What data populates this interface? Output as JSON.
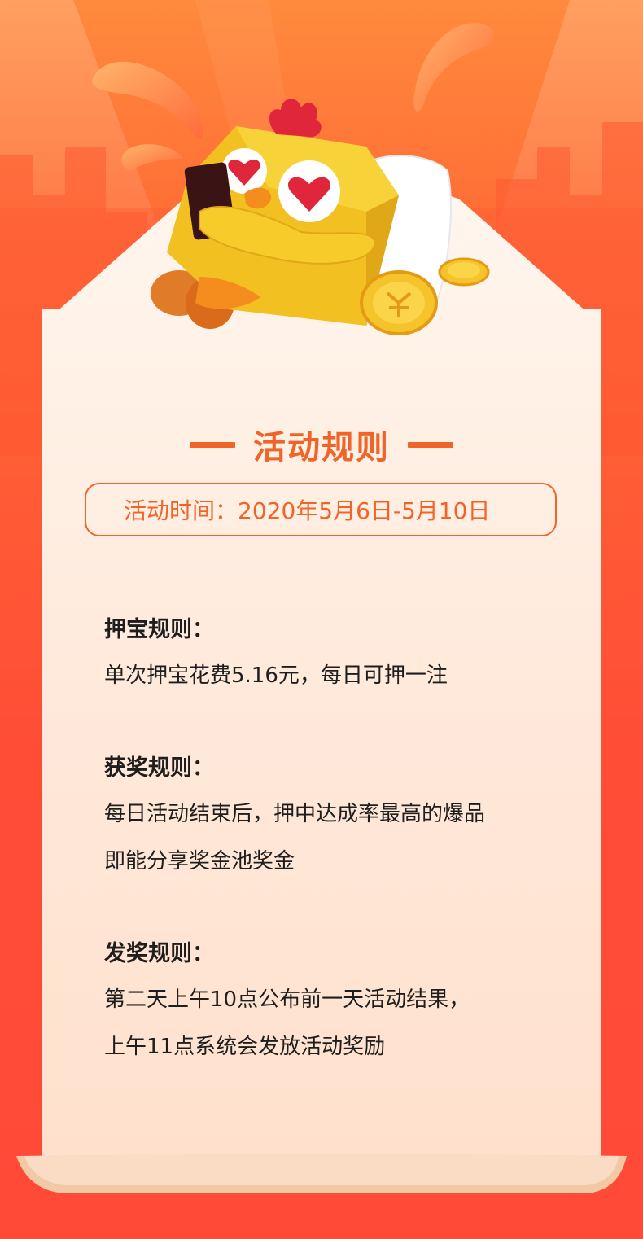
{
  "header": {
    "title": "活动规则",
    "time_text": "活动时间：2020年5月6日-5月10日"
  },
  "rules": [
    {
      "heading": "押宝规则：",
      "lines": [
        "单次押宝花费5.16元，每日可押一注"
      ]
    },
    {
      "heading": "获奖规则：",
      "lines": [
        "每日活动结束后，押中达成率最高的爆品",
        "即能分享奖金池奖金"
      ]
    },
    {
      "heading": "发奖规则：",
      "lines": [
        "第二天上午10点公布前一天活动结果，",
        "上午11点系统会发放活动奖励"
      ]
    }
  ],
  "icons": {
    "mascot": "chicken-mascot-with-phone-icon",
    "coins": "gold-coin-icon"
  },
  "colors": {
    "accent": "#f0642a",
    "bg_top": "#ff8a3d",
    "bg_bottom": "#ff4a38",
    "paper": "#fff0e4",
    "text": "#1e1e1e"
  }
}
